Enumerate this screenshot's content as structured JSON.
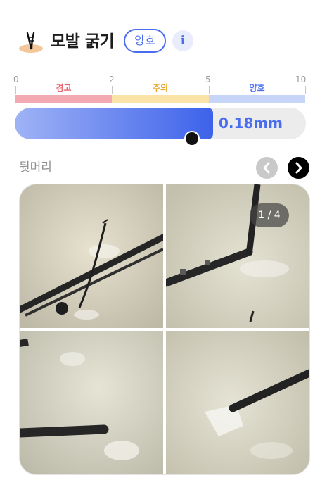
{
  "header": {
    "title": "모발 굵기",
    "status_badge": "양호",
    "info_icon_label": "i",
    "icon_name": "hair-strand-icon"
  },
  "scale": {
    "ticks": [
      "0",
      "2",
      "5",
      "10"
    ],
    "zones": [
      {
        "label": "경고",
        "color": "#f2a9b1",
        "text_color": "#e9626e"
      },
      {
        "label": "주의",
        "color": "#fbe2a6",
        "text_color": "#eba629"
      },
      {
        "label": "양호",
        "color": "#c7d5f9",
        "text_color": "#4a6df0"
      }
    ]
  },
  "gauge": {
    "value_text": "0.18mm",
    "fill_fraction": 0.68,
    "fill_color": "#3d62ea"
  },
  "location": {
    "label": "뒷머리"
  },
  "gallery": {
    "page_counter": "1 / 4",
    "prev_icon": "chevron-left-icon",
    "next_icon": "chevron-right-icon",
    "prev_enabled": false,
    "next_enabled": true,
    "images": [
      "hair-closeup-1",
      "hair-closeup-2",
      "hair-closeup-3",
      "hair-closeup-4"
    ]
  },
  "colors": {
    "accent": "#4a6df0",
    "warning": "#e9626e",
    "caution": "#eba629"
  }
}
